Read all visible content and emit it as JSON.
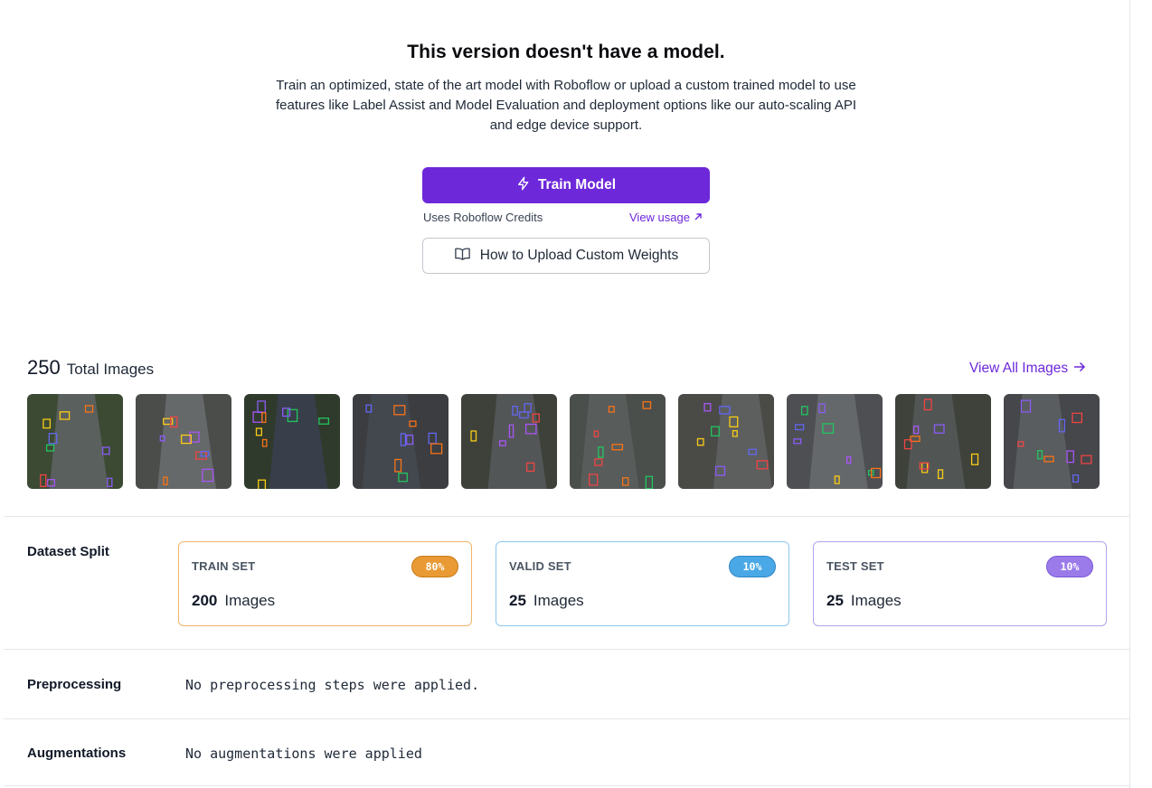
{
  "empty_model": {
    "title": "This version doesn't have a model.",
    "description": "Train an optimized, state of the art model with Roboflow or upload a custom trained model to use features like Label Assist and Model Evaluation and deployment options like our auto-scaling API and edge device support.",
    "train_button_label": "Train Model",
    "train_button_icon": "lightning-icon",
    "credits_label": "Uses Roboflow Credits",
    "view_usage_label": "View usage",
    "view_usage_icon": "arrow-up-right-icon",
    "upload_button_label": "How to Upload Custom Weights",
    "upload_button_icon": "book-open-icon"
  },
  "images": {
    "total_count": "250",
    "total_label": "Total Images",
    "view_all_label": "View All Images",
    "view_all_icon": "arrow-right-icon",
    "thumbnails": [
      {
        "id": "thumb-1",
        "icon": "aerial-road-image"
      },
      {
        "id": "thumb-2",
        "icon": "aerial-road-image"
      },
      {
        "id": "thumb-3",
        "icon": "aerial-road-image"
      },
      {
        "id": "thumb-4",
        "icon": "aerial-road-image"
      },
      {
        "id": "thumb-5",
        "icon": "aerial-road-image"
      },
      {
        "id": "thumb-6",
        "icon": "aerial-road-image"
      },
      {
        "id": "thumb-7",
        "icon": "aerial-road-image"
      },
      {
        "id": "thumb-8",
        "icon": "aerial-road-image"
      },
      {
        "id": "thumb-9",
        "icon": "aerial-road-image"
      },
      {
        "id": "thumb-10",
        "icon": "aerial-road-image"
      }
    ]
  },
  "dataset_split": {
    "label": "Dataset Split",
    "sets": [
      {
        "name": "TRAIN SET",
        "percent": "80%",
        "count": "200",
        "unit": "Images",
        "color": "#e99a34"
      },
      {
        "name": "VALID SET",
        "percent": "10%",
        "count": "25",
        "unit": "Images",
        "color": "#4ba8e6"
      },
      {
        "name": "TEST SET",
        "percent": "10%",
        "count": "25",
        "unit": "Images",
        "color": "#9b7bea"
      }
    ]
  },
  "preprocessing": {
    "label": "Preprocessing",
    "value": "No preprocessing steps were applied."
  },
  "augmentations": {
    "label": "Augmentations",
    "value": "No augmentations were applied"
  },
  "colors": {
    "accent": "#6d28d9",
    "border": "#e5e7eb"
  }
}
